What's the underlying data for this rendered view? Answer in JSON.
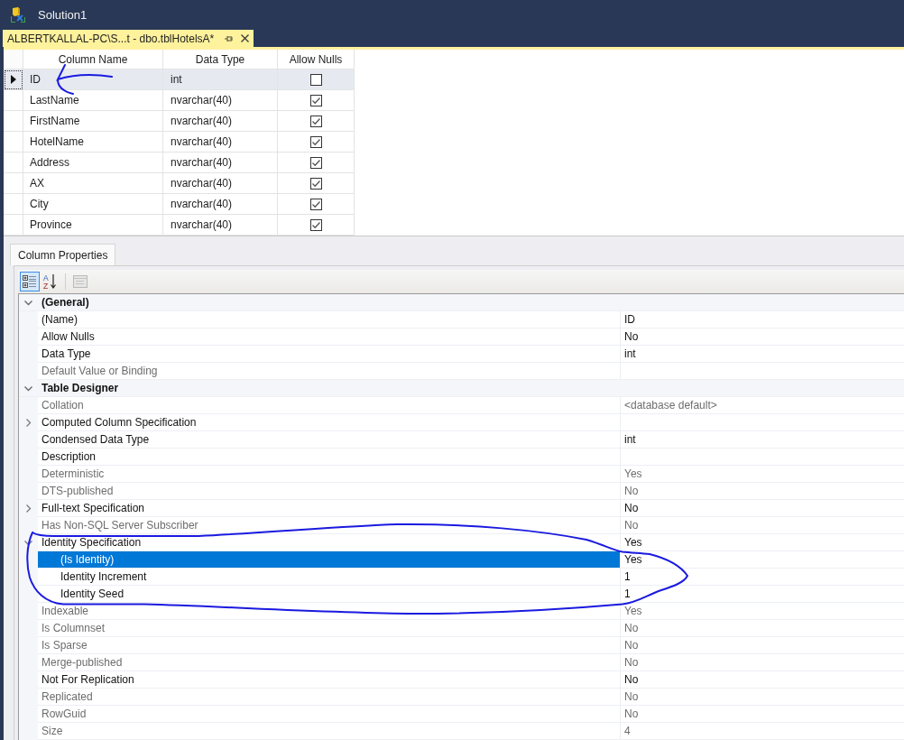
{
  "window": {
    "title": "Solution1"
  },
  "document_tab": {
    "label": "ALBERTKALLAL-PC\\S...t - dbo.tblHotelsA*"
  },
  "table_grid": {
    "columns": [
      "Column Name",
      "Data Type",
      "Allow Nulls"
    ],
    "rows": [
      {
        "column_name": "ID",
        "data_type": "int",
        "allow_nulls": false,
        "selected": true
      },
      {
        "column_name": "LastName",
        "data_type": "nvarchar(40)",
        "allow_nulls": true,
        "selected": false
      },
      {
        "column_name": "FirstName",
        "data_type": "nvarchar(40)",
        "allow_nulls": true,
        "selected": false
      },
      {
        "column_name": "HotelName",
        "data_type": "nvarchar(40)",
        "allow_nulls": true,
        "selected": false
      },
      {
        "column_name": "Address",
        "data_type": "nvarchar(40)",
        "allow_nulls": true,
        "selected": false
      },
      {
        "column_name": "AX",
        "data_type": "nvarchar(40)",
        "allow_nulls": true,
        "selected": false
      },
      {
        "column_name": "City",
        "data_type": "nvarchar(40)",
        "allow_nulls": true,
        "selected": false
      },
      {
        "column_name": "Province",
        "data_type": "nvarchar(40)",
        "allow_nulls": true,
        "selected": false
      }
    ]
  },
  "properties_tab": {
    "label": "Column Properties"
  },
  "properties_toolbar": [
    {
      "kind": "categorized",
      "selected": true,
      "disabled": false
    },
    {
      "kind": "alphabetical",
      "letters": [
        "A",
        "Z"
      ],
      "selected": false,
      "disabled": false
    },
    {
      "kind": "property_pages",
      "selected": false,
      "disabled": true
    }
  ],
  "properties": [
    {
      "category": "(General)",
      "expanded": true,
      "items": [
        {
          "kind": "property",
          "name": "(Name)",
          "value": "ID",
          "read_only": false,
          "selected": false
        },
        {
          "kind": "property",
          "name": "Allow Nulls",
          "value": "No",
          "read_only": false,
          "selected": false
        },
        {
          "kind": "property",
          "name": "Data Type",
          "value": "int",
          "read_only": false,
          "selected": false
        },
        {
          "kind": "property",
          "name": "Default Value or Binding",
          "read_only": true,
          "selected": false
        }
      ]
    },
    {
      "category": "Table Designer",
      "expanded": true,
      "items": [
        {
          "kind": "property",
          "name": "Collation",
          "value": "<database default>",
          "read_only": true,
          "selected": false
        },
        {
          "kind": "group",
          "name": "Computed Column Specification",
          "expanded": false,
          "read_only": false,
          "selected": false
        },
        {
          "kind": "property",
          "name": "Condensed Data Type",
          "value": "int",
          "read_only": false,
          "selected": false
        },
        {
          "kind": "property",
          "name": "Description",
          "read_only": false,
          "selected": false
        },
        {
          "kind": "property",
          "name": "Deterministic",
          "value": "Yes",
          "read_only": true,
          "selected": false
        },
        {
          "kind": "property",
          "name": "DTS-published",
          "value": "No",
          "read_only": true,
          "selected": false
        },
        {
          "kind": "group",
          "name": "Full-text Specification",
          "value": "No",
          "expanded": false,
          "read_only": false,
          "selected": false
        },
        {
          "kind": "property",
          "name": "Has Non-SQL Server Subscriber",
          "value": "No",
          "read_only": true,
          "selected": false
        },
        {
          "kind": "group",
          "name": "Identity Specification",
          "value": "Yes",
          "expanded": true,
          "read_only": false,
          "selected": false,
          "children": [
            {
              "kind": "property",
              "name": "(Is Identity)",
              "value": "Yes",
              "read_only": false,
              "selected": true
            },
            {
              "kind": "property",
              "name": "Identity Increment",
              "value": "1",
              "read_only": false,
              "selected": false
            },
            {
              "kind": "property",
              "name": "Identity Seed",
              "value": "1",
              "read_only": false,
              "selected": false
            }
          ]
        },
        {
          "kind": "property",
          "name": "Indexable",
          "value": "Yes",
          "read_only": true,
          "selected": false
        },
        {
          "kind": "property",
          "name": "Is Columnset",
          "value": "No",
          "read_only": true,
          "selected": false
        },
        {
          "kind": "property",
          "name": "Is Sparse",
          "value": "No",
          "read_only": true,
          "selected": false
        },
        {
          "kind": "property",
          "name": "Merge-published",
          "value": "No",
          "read_only": true,
          "selected": false
        },
        {
          "kind": "property",
          "name": "Not For Replication",
          "value": "No",
          "read_only": false,
          "selected": false
        },
        {
          "kind": "property",
          "name": "Replicated",
          "value": "No",
          "read_only": true,
          "selected": false
        },
        {
          "kind": "property",
          "name": "RowGuid",
          "value": "No",
          "read_only": true,
          "selected": false
        },
        {
          "kind": "property",
          "name": "Size",
          "value": "4",
          "read_only": true,
          "selected": false
        }
      ]
    }
  ]
}
